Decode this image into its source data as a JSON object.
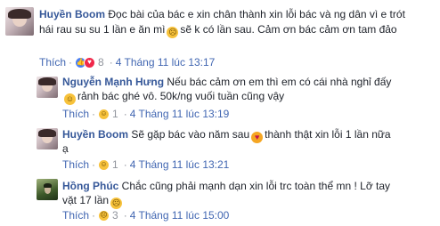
{
  "comments": [
    {
      "author": "Huyền Boom",
      "line1": "Đọc bài của bác e xin chân thành xin lỗi bác và ng dân vì e trót",
      "line2a": "hái rau su su 1 lần e ăn mì",
      "line2_emoji": "frown-emoji",
      "line2b": "sẽ k có lần sau. Cảm ơn bác cảm ơn tam đảo",
      "like_label": "Thích",
      "reactions": [
        "like",
        "love"
      ],
      "reaction_count": "8",
      "timestamp": "4 Tháng 11 lúc 13:17"
    },
    {
      "author": "Nguyễn Mạnh Hưng",
      "line1": "Nếu bác cảm ơn em thì em có cái nhà nghỉ đấy",
      "line2_emoji": "grin-emoji",
      "line2": "rảnh bác ghé vô. 50k/ng vuối tuần cũng vậy",
      "like_label": "Thích",
      "reactions": [
        "haha"
      ],
      "reaction_count": "1",
      "timestamp": "4 Tháng 11 lúc 13:19"
    },
    {
      "author": "Huyền Boom",
      "line1a": "Sẽ gặp bác vào năm sau",
      "line1_emoji": "kiss-emoji",
      "line1b": "thành thật xin lỗi 1 lần nữa",
      "line2": "ạ",
      "like_label": "Thích",
      "reactions": [
        "haha"
      ],
      "reaction_count": "1",
      "timestamp": "4 Tháng 11 lúc 13:21"
    },
    {
      "author": "Hồng Phúc",
      "line1": "Chắc cũng phải mạnh dạn xin lỗi trc toàn thể mn ! Lỡ tay",
      "line2": "vặt 17 lần",
      "line2_emoji": "frown-emoji",
      "like_label": "Thích",
      "reactions": [
        "sad"
      ],
      "reaction_count": "3",
      "timestamp": "4 Tháng 11 lúc 15:00"
    }
  ],
  "colors": {
    "name": "#365899",
    "link": "#4267b2",
    "meta": "#90949c",
    "text": "#1d2129"
  }
}
